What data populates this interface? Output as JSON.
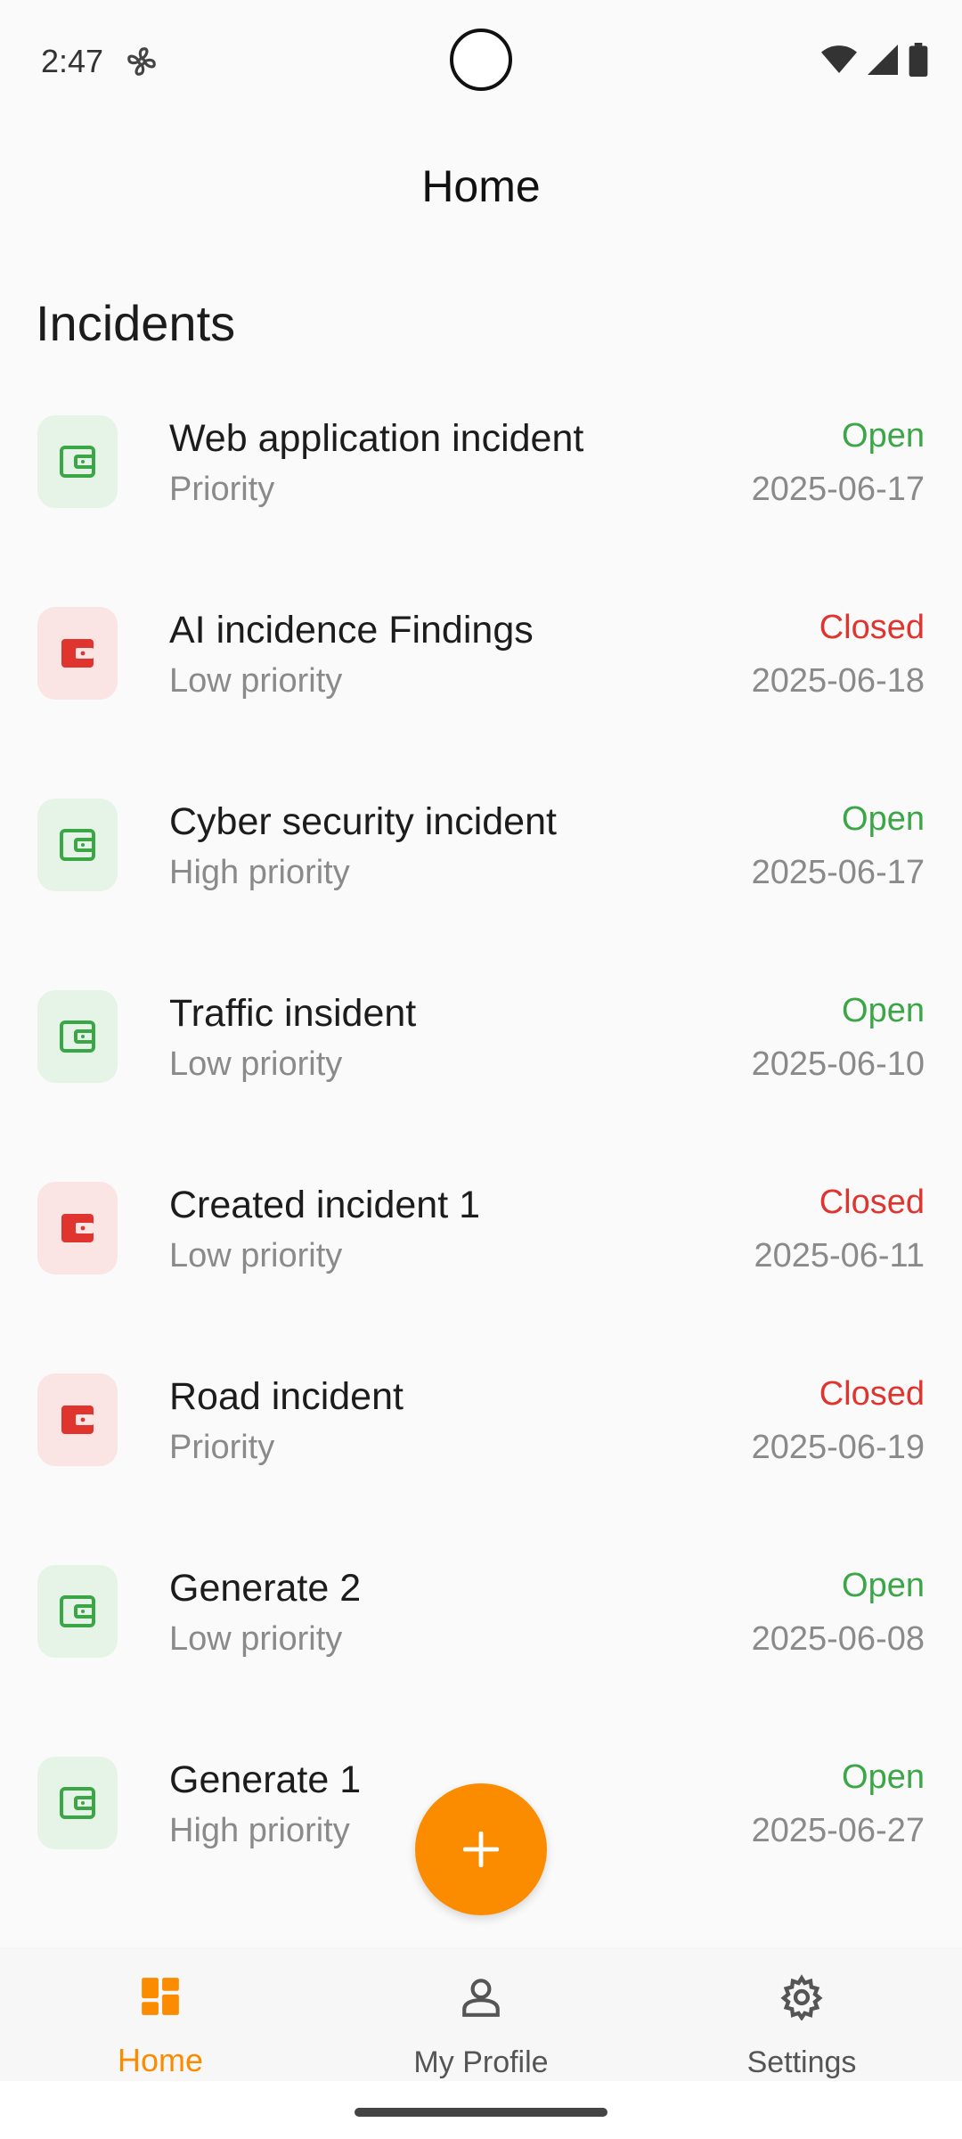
{
  "status_bar": {
    "time": "2:47"
  },
  "app_bar": {
    "title": "Home"
  },
  "section": {
    "title": "Incidents"
  },
  "colors": {
    "accent": "#fb8c00",
    "open": "#3aa646",
    "closed": "#e0352f"
  },
  "incidents": [
    {
      "title": "Web application incident",
      "priority": "Priority",
      "status": "Open",
      "date": "2025-06-17",
      "icon": "wallet-icon"
    },
    {
      "title": "AI incidence Findings",
      "priority": "Low priority",
      "status": "Closed",
      "date": "2025-06-18",
      "icon": "wallet-icon"
    },
    {
      "title": "Cyber security incident",
      "priority": "High priority",
      "status": "Open",
      "date": "2025-06-17",
      "icon": "wallet-icon"
    },
    {
      "title": "Traffic insident",
      "priority": "Low priority",
      "status": "Open",
      "date": "2025-06-10",
      "icon": "wallet-icon"
    },
    {
      "title": "Created incident 1",
      "priority": "Low priority",
      "status": "Closed",
      "date": "2025-06-11",
      "icon": "wallet-icon"
    },
    {
      "title": "Road incident",
      "priority": "Priority",
      "status": "Closed",
      "date": "2025-06-19",
      "icon": "wallet-icon"
    },
    {
      "title": "Generate 2",
      "priority": "Low priority",
      "status": "Open",
      "date": "2025-06-08",
      "icon": "wallet-icon"
    },
    {
      "title": "Generate 1",
      "priority": "High priority",
      "status": "Open",
      "date": "2025-06-27",
      "icon": "wallet-icon"
    }
  ],
  "fab": {
    "icon": "plus-icon"
  },
  "bottom_nav": [
    {
      "label": "Home",
      "icon": "dashboard-icon",
      "active": true
    },
    {
      "label": "My Profile",
      "icon": "person-icon",
      "active": false
    },
    {
      "label": "Settings",
      "icon": "gear-icon",
      "active": false
    }
  ]
}
